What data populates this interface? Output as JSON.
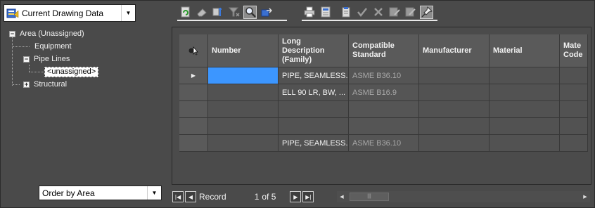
{
  "data_source": {
    "selected": "Current Drawing Data"
  },
  "tree": {
    "root": "Area (Unassigned)",
    "root_toggle": "−",
    "items": [
      {
        "label": "Equipment"
      },
      {
        "label": "Pipe Lines",
        "toggle": "−",
        "children": [
          {
            "label": "<unassigned>"
          }
        ]
      },
      {
        "label": "Structural",
        "toggle": "+"
      }
    ]
  },
  "order_by": {
    "selected": "Order by Area"
  },
  "toolbar": {
    "group1": [
      {
        "icon": "refresh-icon"
      },
      {
        "icon": "eraser-icon"
      },
      {
        "icon": "locate-icon"
      },
      {
        "icon": "filter-icon"
      },
      {
        "icon": "zoom-icon",
        "active": true
      },
      {
        "icon": "export-icon"
      }
    ],
    "group2": [
      {
        "icon": "print-icon"
      },
      {
        "icon": "report-icon"
      },
      {
        "icon": "paste-icon"
      },
      {
        "icon": "check-icon"
      },
      {
        "icon": "delete-icon"
      },
      {
        "icon": "edit-icon"
      },
      {
        "icon": "edit-alt-icon"
      },
      {
        "icon": "pin-icon",
        "active": true
      }
    ]
  },
  "grid": {
    "columns": [
      "",
      "Number",
      "Long Description (Family)",
      "Compatible Standard",
      "Manufacturer",
      "Material",
      "Material Code"
    ],
    "column_display": [
      "",
      "Number",
      "Long Description (Family)",
      "Compatible Standard",
      "Manufacturer",
      "Material",
      "Mate Code"
    ],
    "rows": [
      {
        "current": true,
        "number": "",
        "description": "PIPE, SEAMLESS...",
        "standard": "ASME B36.10",
        "manufacturer": "",
        "material": "",
        "material_code": ""
      },
      {
        "current": false,
        "number": "",
        "description": "ELL 90 LR, BW, ...",
        "standard": "ASME B16.9",
        "manufacturer": "",
        "material": "",
        "material_code": ""
      },
      {
        "current": false,
        "number": "",
        "description": "",
        "standard": "",
        "manufacturer": "",
        "material": "",
        "material_code": ""
      },
      {
        "current": false,
        "number": "",
        "description": "",
        "standard": "",
        "manufacturer": "",
        "material": "",
        "material_code": ""
      },
      {
        "current": false,
        "number": "",
        "description": "PIPE, SEAMLESS...",
        "standard": "ASME B36.10",
        "manufacturer": "",
        "material": "",
        "material_code": ""
      }
    ]
  },
  "record_nav": {
    "label": "Record",
    "current": "1",
    "of_text": "of 5"
  },
  "colors": {
    "selection": "#3c96ff",
    "background": "#4a4a4a"
  }
}
